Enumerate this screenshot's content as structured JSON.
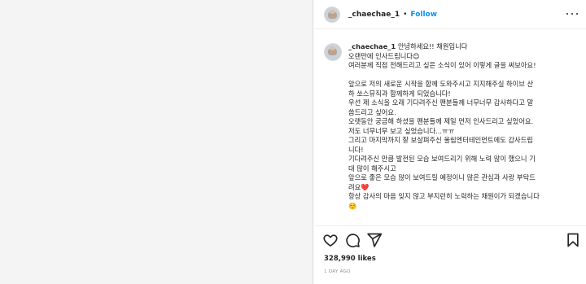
{
  "header": {
    "username": "_chaechae_1",
    "separator": "•",
    "follow_label": "Follow",
    "more_icon": "more-horizontal-icon"
  },
  "caption": {
    "username": "_chaechae_1",
    "lines": [
      "안녕하세요!! 채원입니다",
      "오랜만에 인사드립니다😊",
      "여러분께 직접 전해드리고 싶은 소식이 있어 이렇게 글을 써보아요!",
      "",
      "앞으로 저의 새로운 시작을 함께 도와주시고 지지해주실 하이브 산",
      "하 쏘스뮤직과 함께하게 되었습니다!",
      "우선 제 소식을 오래 기다려주신 팬분들께 너무너무 감사하다고 말",
      "씀드리고 싶어요.",
      "오랫동안 궁금해 하셨을 팬분들께 제일 먼저 인사드리고 싶었어요.",
      "저도 너무너무 보고 싶었습니다...ㅠㅠ",
      "그리고 마지막까지 잘 보살펴주신 울림엔터테인먼트에도 감사드립",
      "니다!",
      "기다려주신 만큼 발전된 모습 보여드리기 위해 노력 많이 했으니 기",
      "대 많이 해주시고",
      "앞으로 좋은 모습 많이 보여드릴 예정이니 많은 관심과 사랑 부탁드",
      "려요❤️",
      "항상 감사의 마음 잊지 않고 부지런히 노력하는 채원이가 되겠습니다",
      "☺️"
    ]
  },
  "actions": {
    "like_icon": "heart-icon",
    "comment_icon": "comment-icon",
    "share_icon": "send-icon",
    "save_icon": "bookmark-icon"
  },
  "likes": "328,990 likes",
  "timestamp": "1 DAY AGO",
  "colors": {
    "accent": "#0095f6",
    "text": "#262626",
    "muted": "#8e8e8e",
    "border": "#efefef"
  }
}
